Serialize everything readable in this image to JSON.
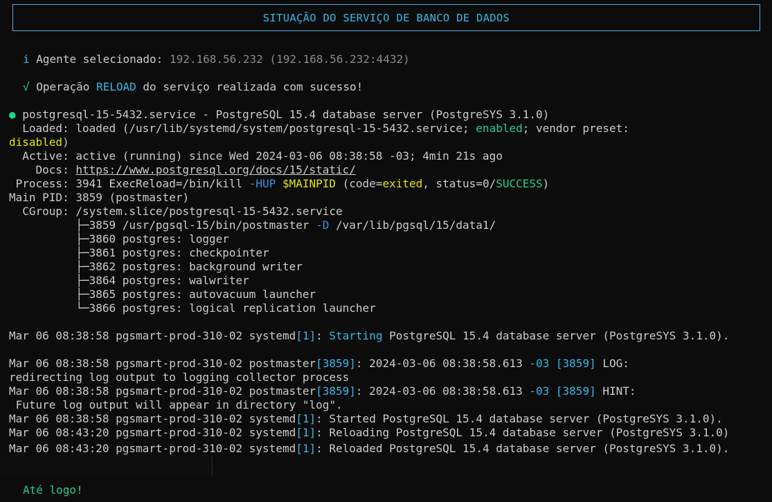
{
  "header": {
    "title": "SITUAÇÃO DO SERVIÇO DE BANCO DE DADOS"
  },
  "info": {
    "icon": "i",
    "label": "Agente selecionado: ",
    "agent": "192.168.56.232 (192.168.56.232:4432)"
  },
  "result": {
    "icon": "√",
    "pre": "Operação ",
    "op": "RELOAD",
    "post": " do serviço realizada com sucesso!"
  },
  "status": {
    "bullet": "●",
    "service_line": " postgresql-15-5432.service - PostgreSQL 15.4 database server (PostgreSYS 3.1.0)",
    "loaded_pre": "  Loaded: loaded (/usr/lib/systemd/system/postgresql-15-5432.service; ",
    "loaded_enabled": "enabled",
    "loaded_post": "; vendor preset:",
    "loaded_disabled": "disabled",
    "loaded_close": ")",
    "active": "  Active: active (running) since Wed 2024-03-06 08:38:58 -03; 4min 21s ago",
    "docs_label": "    Docs: ",
    "docs_link": "https://www.postgresql.org/docs/15/static/",
    "process_pre": " Process: 3941 ExecReload=/bin/kill ",
    "process_hup": "-HUP",
    "process_sp": " ",
    "process_var": "$MAINPID",
    "process_code": " (code=",
    "process_exited": "exited",
    "process_status": ", status=0/",
    "process_success": "SUCCESS",
    "process_close": ")",
    "mainpid": "Main PID: 3859 (postmaster)",
    "cgroup": "  CGroup: /system.slice/postgresql-15-5432.service",
    "tree": [
      {
        "prefix": "          ├─3859 /usr/pgsql-15/bin/postmaster ",
        "flag": "-D",
        "rest": " /var/lib/pgsql/15/data1/"
      },
      {
        "prefix": "          ├─3860 postgres: logger",
        "flag": "",
        "rest": ""
      },
      {
        "prefix": "          ├─3861 postgres: checkpointer",
        "flag": "",
        "rest": ""
      },
      {
        "prefix": "          ├─3862 postgres: background writer",
        "flag": "",
        "rest": ""
      },
      {
        "prefix": "          ├─3864 postgres: walwriter",
        "flag": "",
        "rest": ""
      },
      {
        "prefix": "          ├─3865 postgres: autovacuum launcher",
        "flag": "",
        "rest": ""
      },
      {
        "prefix": "          └─3866 postgres: logical replication launcher",
        "flag": "",
        "rest": ""
      }
    ]
  },
  "log": {
    "l1": {
      "pre": "Mar 06 08:38:58 pgsmart-prod-310-02 systemd",
      "pid": "[1]",
      "colon": ": ",
      "kw": "Starting",
      "rest": " PostgreSQL 15.4 database server (PostgreSYS 3.1.0)."
    },
    "l2": {
      "pre": "Mar 06 08:38:58 pgsmart-prod-310-02 postmaster",
      "pid": "[3859]",
      "mid": ": 2024-03-06 08:38:58.613 ",
      "tz": "-03",
      "sp": " ",
      "pid2": "[3859]",
      "end": " LOG:"
    },
    "l2b": "redirecting log output to logging collector process",
    "l3": {
      "pre": "Mar 06 08:38:58 pgsmart-prod-310-02 postmaster",
      "pid": "[3859]",
      "mid": ": 2024-03-06 08:38:58.613 ",
      "tz": "-03",
      "sp": " ",
      "pid2": "[3859]",
      "end": " HINT:"
    },
    "l3b": " Future log output will appear in directory \"log\".",
    "l4": {
      "pre": "Mar 06 08:38:58 pgsmart-prod-310-02 systemd",
      "pid": "[1]",
      "rest": ": Started PostgreSQL 15.4 database server (PostgreSYS 3.1.0)."
    },
    "l5": {
      "pre": "Mar 06 08:43:20 pgsmart-prod-310-02 systemd",
      "pid": "[1]",
      "rest": ": Reloading PostgreSQL 15.4 database server (PostgreSYS 3.1.0)"
    },
    "l6": {
      "pre": "Mar 06 08:43:20 pgsmart-prod-310-02 systemd",
      "pid": "[1]",
      "rest": ": Reloaded PostgreSQL 15.4 database server (PostgreSYS 3.1.0)."
    }
  },
  "farewell": "Até logo!"
}
